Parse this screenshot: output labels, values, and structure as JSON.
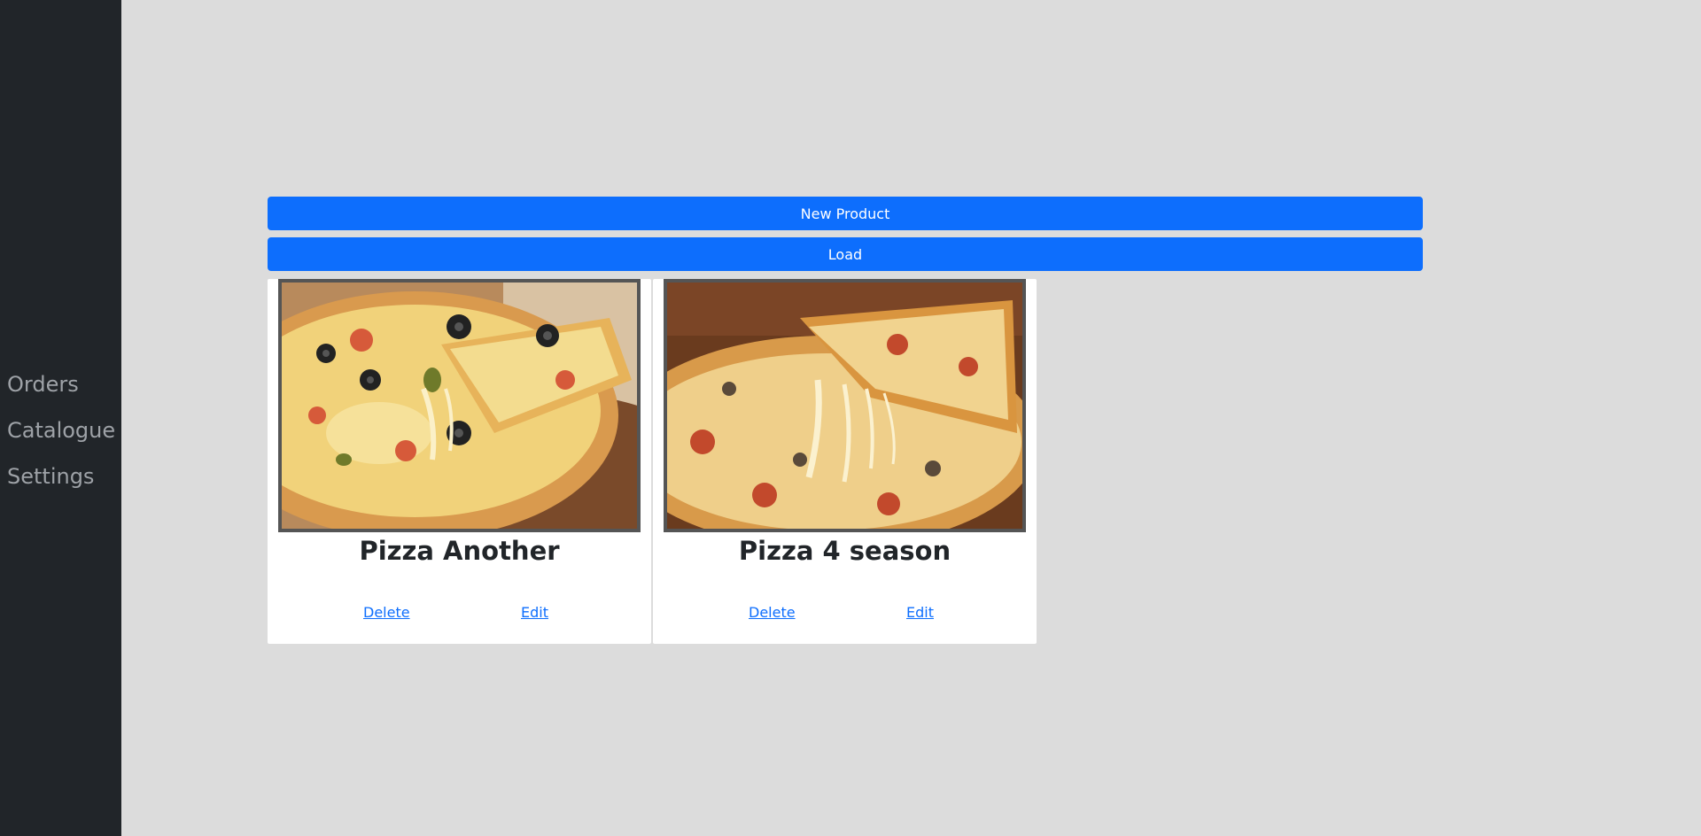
{
  "sidebar": {
    "items": [
      {
        "label": "Orders"
      },
      {
        "label": "Catalogue"
      },
      {
        "label": "Settings"
      }
    ]
  },
  "actions": {
    "new_product_label": "New Product",
    "load_label": "Load"
  },
  "products": [
    {
      "name": "Pizza Another",
      "delete_label": "Delete",
      "edit_label": "Edit",
      "image": "pizza-photo"
    },
    {
      "name": "Pizza 4 season",
      "delete_label": "Delete",
      "edit_label": "Edit",
      "image": "pizza-photo"
    }
  ],
  "colors": {
    "sidebar_bg": "#212529",
    "page_bg": "#dcdcdc",
    "primary": "#0d6efd",
    "link": "#0d6efd"
  }
}
